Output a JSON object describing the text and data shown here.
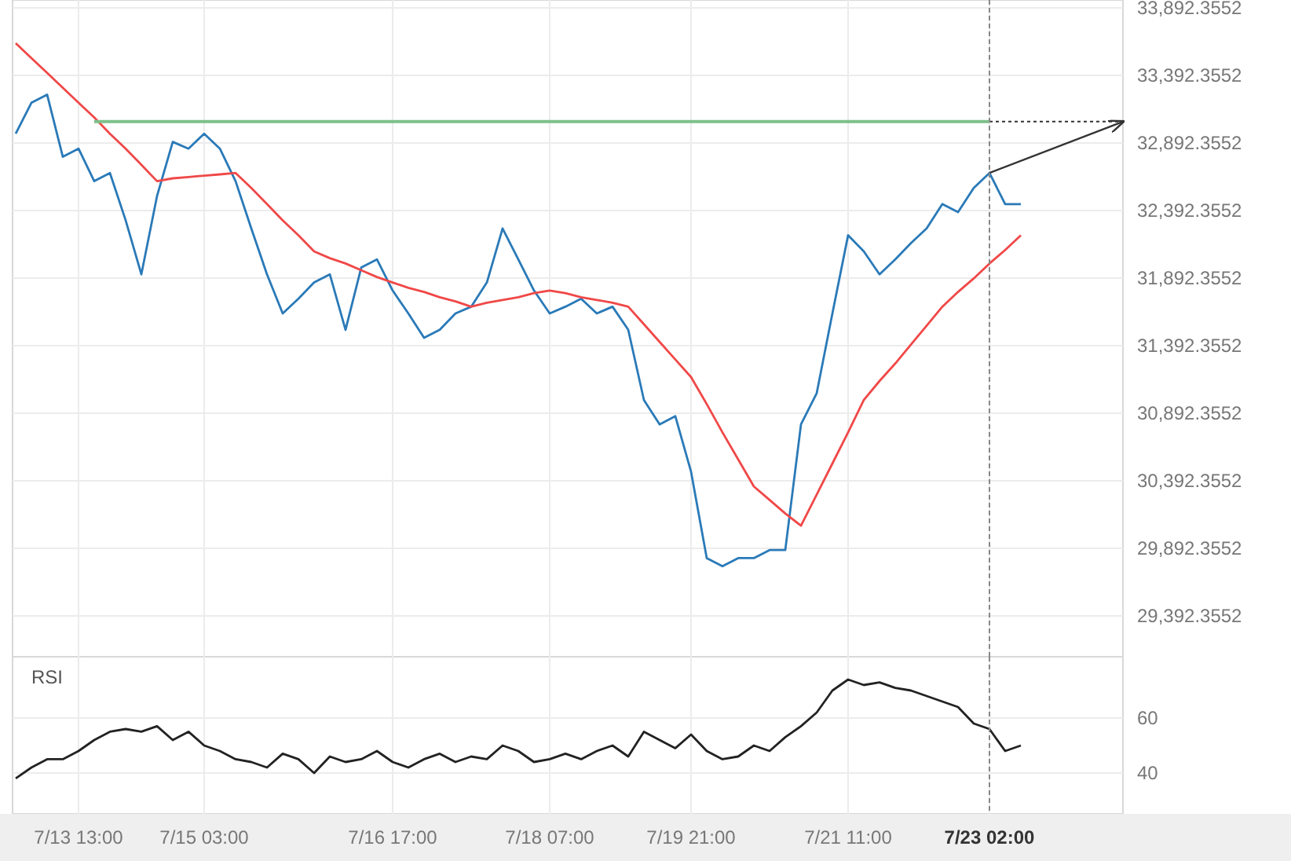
{
  "price_chart": {
    "chart_data": {
      "type": "line",
      "grid": true,
      "ylim": [
        29090,
        33950
      ],
      "yticks": [
        {
          "value": 33892.3552,
          "label": "33,892.3552"
        },
        {
          "value": 33392.3552,
          "label": "33,392.3552"
        },
        {
          "value": 32892.3552,
          "label": "32,892.3552"
        },
        {
          "value": 32392.3552,
          "label": "32,392.3552"
        },
        {
          "value": 31892.3552,
          "label": "31,892.3552"
        },
        {
          "value": 31392.3552,
          "label": "31,392.3552"
        },
        {
          "value": 30892.3552,
          "label": "30,892.3552"
        },
        {
          "value": 30392.3552,
          "label": "30,392.3552"
        },
        {
          "value": 29892.3552,
          "label": "29,892.3552"
        },
        {
          "value": 29392.3552,
          "label": "29,392.3552"
        }
      ],
      "ref_lines": [
        {
          "axis": "y",
          "value": 33050,
          "color": "#7cc08a"
        }
      ],
      "series": [
        {
          "color": "#2a7ab8",
          "values": [
            32960,
            33190,
            33250,
            32790,
            32850,
            32610,
            32670,
            32320,
            31920,
            32500,
            32900,
            32850,
            32960,
            32850,
            32610,
            32260,
            31920,
            31630,
            31740,
            31860,
            31920,
            31510,
            31970,
            32030,
            31800,
            31630,
            31450,
            31510,
            31630,
            31680,
            31860,
            32260,
            32030,
            31800,
            31630,
            31680,
            31740,
            31630,
            31680,
            31510,
            30990,
            30810,
            30870,
            30460,
            29820,
            29760,
            29820,
            29820,
            29880,
            29880,
            30810,
            31040,
            31630,
            32210,
            32090,
            31920,
            32030,
            32150,
            32260,
            32440,
            32380,
            32560,
            32670,
            32440,
            32440
          ]
        },
        {
          "color": "#f04848",
          "values": [
            33630,
            33520,
            33410,
            33300,
            33190,
            33080,
            32960,
            32850,
            32730,
            32610,
            32630,
            32640,
            32650,
            32660,
            32670,
            32560,
            32440,
            32320,
            32210,
            32090,
            32040,
            32000,
            31950,
            31900,
            31860,
            31820,
            31790,
            31750,
            31720,
            31680,
            31710,
            31730,
            31750,
            31780,
            31800,
            31780,
            31750,
            31730,
            31710,
            31680,
            31550,
            31420,
            31290,
            31160,
            30960,
            30750,
            30550,
            30350,
            30250,
            30150,
            30060,
            30290,
            30520,
            30750,
            30990,
            31130,
            31260,
            31400,
            31540,
            31680,
            31790,
            31890,
            32000,
            32100,
            32210
          ]
        }
      ]
    }
  },
  "rsi_chart": {
    "chart_data": {
      "type": "line",
      "title": "RSI",
      "grid": true,
      "categories": [
        null,
        null,
        null,
        null,
        "7/13 13:00",
        null,
        null,
        null,
        null,
        null,
        null,
        null,
        "7/15 03:00",
        null,
        null,
        null,
        null,
        null,
        null,
        null,
        null,
        null,
        null,
        null,
        "7/16 17:00",
        null,
        null,
        null,
        null,
        null,
        null,
        null,
        null,
        null,
        "7/18 07:00",
        null,
        null,
        null,
        null,
        null,
        null,
        null,
        null,
        "7/19 21:00",
        null,
        null,
        null,
        null,
        null,
        null,
        null,
        null,
        null,
        "7/21 11:00",
        null,
        null,
        null,
        null,
        null,
        null,
        null,
        null,
        "7/23 02:00",
        null,
        null
      ],
      "ylim": [
        25.1,
        82.3
      ],
      "yticks": [
        40,
        60
      ],
      "series": [
        {
          "color": "#222222",
          "values": [
            38,
            42,
            45,
            45,
            48,
            52,
            55,
            56,
            55,
            57,
            52,
            55,
            50,
            48,
            45,
            44,
            42,
            47,
            45,
            40,
            46,
            44,
            45,
            48,
            44,
            42,
            45,
            47,
            44,
            46,
            45,
            50,
            48,
            44,
            45,
            47,
            45,
            48,
            50,
            46,
            55,
            52,
            49,
            54,
            48,
            45,
            46,
            50,
            48,
            53,
            57,
            62,
            70,
            74,
            72,
            73,
            71,
            70,
            68,
            66,
            64,
            58,
            56,
            48,
            50
          ]
        }
      ]
    }
  }
}
